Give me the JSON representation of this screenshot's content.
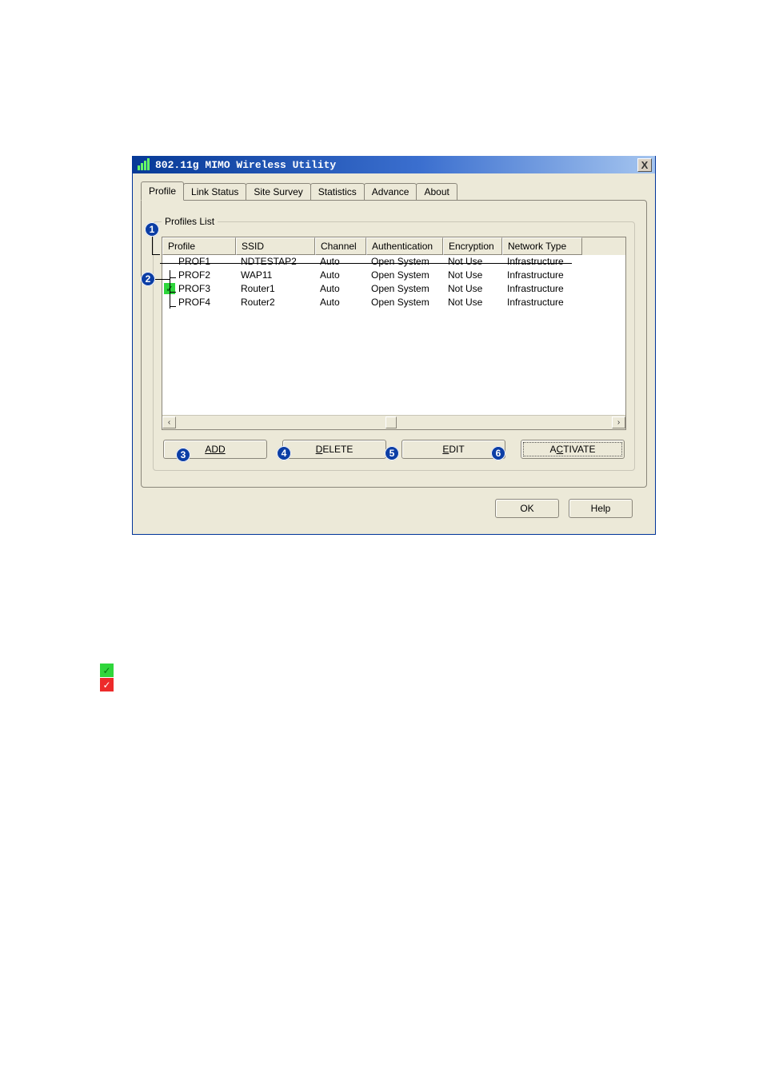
{
  "window": {
    "title": "802.11g MIMO Wireless Utility",
    "icon": "signal-bars-icon",
    "close_label": "X"
  },
  "tabs": {
    "profile": "Profile",
    "link_status": "Link Status",
    "site_survey": "Site Survey",
    "statistics": "Statistics",
    "advance": "Advance",
    "about": "About",
    "active_index": 0
  },
  "group": {
    "label": "Profiles List"
  },
  "table": {
    "headers": {
      "profile": "Profile",
      "ssid": "SSID",
      "channel": "Channel",
      "auth": "Authentication",
      "encryption": "Encryption",
      "nettype": "Network Type"
    },
    "rows": [
      {
        "active_check": false,
        "profile": "PROF1",
        "ssid": "NDTESTAP2",
        "channel": "Auto",
        "auth": "Open System",
        "encryption": "Not Use",
        "nettype": "Infrastructure"
      },
      {
        "active_check": false,
        "profile": "PROF2",
        "ssid": "WAP11",
        "channel": "Auto",
        "auth": "Open System",
        "encryption": "Not Use",
        "nettype": "Infrastructure"
      },
      {
        "active_check": true,
        "profile": "PROF3",
        "ssid": "Router1",
        "channel": "Auto",
        "auth": "Open System",
        "encryption": "Not Use",
        "nettype": "Infrastructure"
      },
      {
        "active_check": false,
        "profile": "PROF4",
        "ssid": "Router2",
        "channel": "Auto",
        "auth": "Open System",
        "encryption": "Not Use",
        "nettype": "Infrastructure"
      }
    ]
  },
  "buttons": {
    "add": "ADD",
    "delete": "DELETE",
    "edit": "EDIT",
    "activate": "ACTIVATE",
    "ok": "OK",
    "help": "Help"
  },
  "callouts": {
    "c1": "1",
    "c2": "2",
    "c3": "3",
    "c4": "4",
    "c5": "5",
    "c6": "6"
  },
  "legend": {
    "green": "check-green-icon",
    "red": "check-red-icon"
  }
}
